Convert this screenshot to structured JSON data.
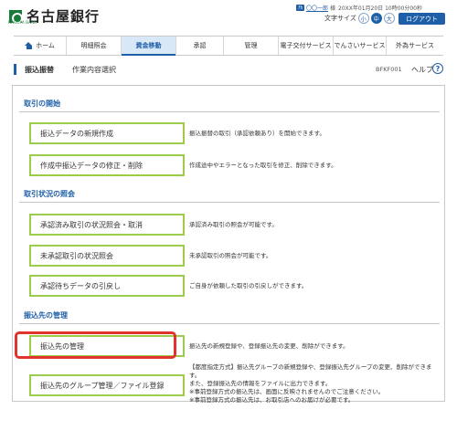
{
  "header": {
    "bank_name": "名古屋銀行",
    "logo_sub": "NAGOYA BANK",
    "user_badge": "ｱｶ",
    "user_name": "〇〇一郎",
    "user_suffix": "様",
    "login_time": "20XX年01月20日 10時00分00秒",
    "font_size_label": "文字サイズ",
    "font_small": "小",
    "font_medium": "中",
    "font_large": "大",
    "logout_label": "ログアウト"
  },
  "nav": {
    "home": "ホーム",
    "items": [
      "明細照会",
      "資金移動",
      "承認",
      "管理",
      "電子交付サービス",
      "でんさいサービス",
      "外為サービス"
    ],
    "active": "資金移動"
  },
  "title": {
    "main": "振込振替",
    "sub": "作業内容選択",
    "screen_code": "BFKF001",
    "help": "ヘルプ",
    "help_icon": "?"
  },
  "sections": [
    {
      "heading": "取引の開始",
      "rows": [
        {
          "button": "振込データの新規作成",
          "desc": "振込振替の取引（承認依頼あり）を開始できます。"
        },
        {
          "button": "作成中振込データの修正・削除",
          "desc": "作成途中やエラーとなった取引を修正、削除できます。"
        }
      ]
    },
    {
      "heading": "取引状況の照会",
      "rows": [
        {
          "button": "承認済み取引の状況照会・取消",
          "desc": "承認済み取引の照会が可能です。"
        },
        {
          "button": "未承認取引の状況照会",
          "desc": "未承認取引の照会が可能です。"
        },
        {
          "button": "承認待ちデータの引戻し",
          "desc": "ご自身が依頼した取引の引戻しができます。"
        }
      ]
    },
    {
      "heading": "振込先の管理",
      "rows": [
        {
          "button": "振込先の管理",
          "desc": "振込先の新規登録や、登録振込先の変更、削除ができます。"
        },
        {
          "button": "振込先のグループ管理／ファイル登録",
          "desc_lines": [
            "【都度指定方式】振込先グループの新規登録や、登録振込先グループの変更、削除ができます。",
            "また、登録振込先の情報をファイルに出力できます。",
            "※事前登録方式の振込先は、画面に反映されませんのでご注意ください。",
            "※事前登録方式の振込先は、お取引店へのお届けが必要です。"
          ]
        }
      ]
    }
  ],
  "colors": {
    "accent": "#1f5fa8",
    "button_border": "#9bcc4b",
    "highlight": "#e0332b",
    "brand": "#1a7a3a"
  }
}
